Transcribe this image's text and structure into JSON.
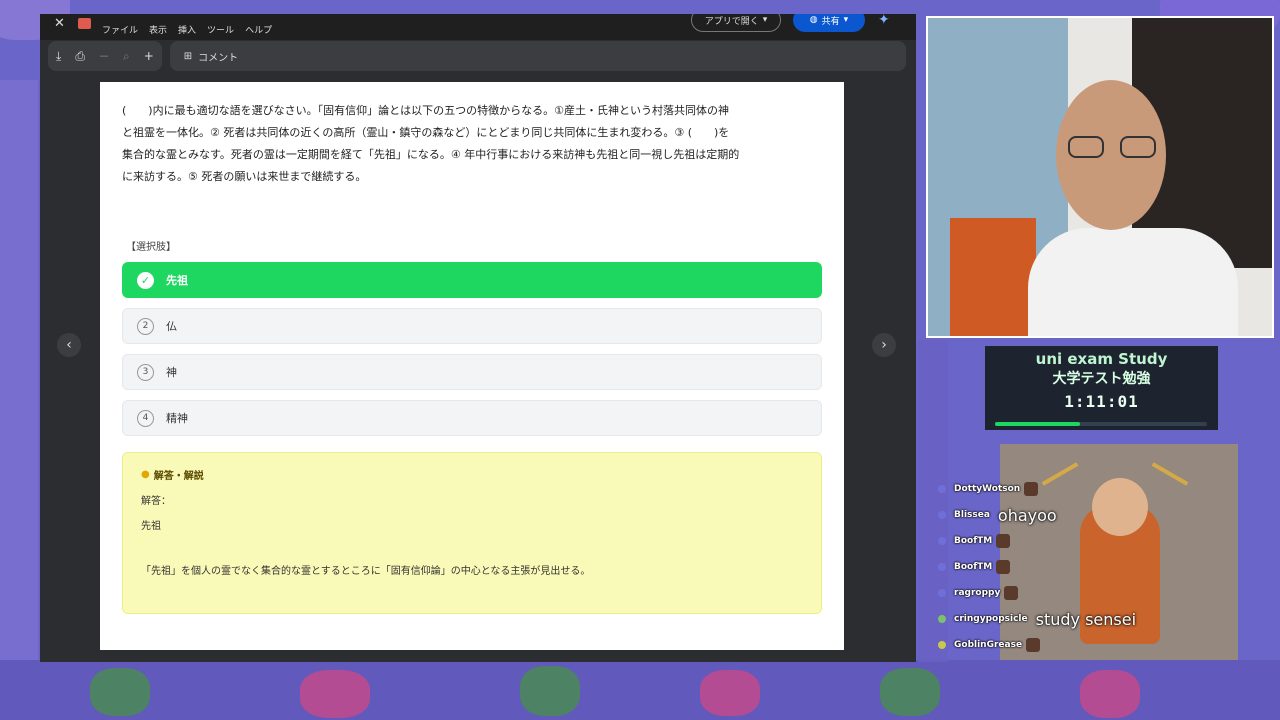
{
  "viewer": {
    "title_menu": [
      "ファイル",
      "表示",
      "挿入",
      "ツール",
      "ヘルプ"
    ],
    "open_with_label": "アプリで開く",
    "share_label": "共有",
    "comment_label": "コメント"
  },
  "page": {
    "question_lines": [
      "(　　)内に最も適切な語を選びなさい。「固有信仰」論とは以下の五つの特徴からなる。①産土・氏神という村落共同体の神",
      "と祖霊を一体化。② 死者は共同体の近くの高所（霊山・鎮守の森など）にとどまり同じ共同体に生まれ変わる。③ (　　)を",
      "集合的な霊とみなす。死者の霊は一定期間を経て「先祖」になる。④ 年中行事における来訪神も先祖と同一視し先祖は定期的",
      "に来訪する。⑤ 死者の願いは来世まで継続する。"
    ],
    "choices_label": "【選択肢】",
    "choices": [
      {
        "num": "✓",
        "label": "先祖",
        "correct": true
      },
      {
        "num": "2",
        "label": "仏",
        "correct": false
      },
      {
        "num": "3",
        "label": "神",
        "correct": false
      },
      {
        "num": "4",
        "label": "精神",
        "correct": false
      }
    ],
    "answer": {
      "heading": "解答・解説",
      "answer_label": "解答：",
      "answer_value": "先祖",
      "explanation": "「先祖」を個人の霊でなく集合的な霊とするところに「固有信仰論」の中心となる主張が見出せる。"
    }
  },
  "timer": {
    "title_en": "uni exam Study",
    "title_jp": "大学テスト勉強",
    "time": "1:11:01",
    "progress": 0.4
  },
  "chat": [
    {
      "user": "DottyWotson",
      "text": ""
    },
    {
      "user": "Blissea",
      "text": "ohayoo"
    },
    {
      "user": "BoofTM",
      "text": ""
    },
    {
      "user": "BoofTM",
      "text": ""
    },
    {
      "user": "ragroppy",
      "text": ""
    },
    {
      "user": "cringypopsicle",
      "text": "study sensei"
    },
    {
      "user": "GoblinGrease",
      "text": ""
    }
  ],
  "colors": {
    "correct": "#1ed760",
    "share_button": "#0b57d0",
    "answer_box": "#fafab8",
    "stream_bg": "#6a66c9"
  },
  "icons": [
    "close-icon",
    "image-file-icon",
    "download-icon",
    "print-icon",
    "zoom-out-icon",
    "zoom-icon",
    "zoom-in-icon",
    "comment-icon",
    "chevron-left-icon",
    "chevron-right-icon",
    "check-icon",
    "lightbulb-icon",
    "globe-icon",
    "sparkle-icon"
  ]
}
